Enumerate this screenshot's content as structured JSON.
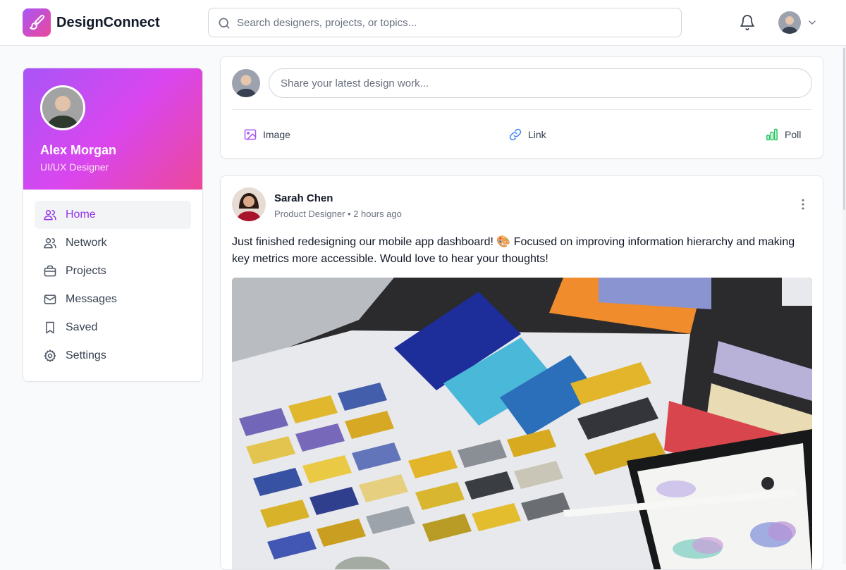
{
  "app": {
    "name": "DesignConnect",
    "brand_gradient": [
      "#a855f7",
      "#ec4899"
    ],
    "accent": "#9333ea",
    "logo_icon": "paintbrush-icon"
  },
  "header": {
    "search_placeholder": "Search designers, projects, or topics...",
    "search_value": "",
    "icons": [
      "search-icon",
      "bell-icon",
      "avatar",
      "chevron-down-icon"
    ]
  },
  "profile": {
    "name": "Alex Morgan",
    "role": "UI/UX Designer"
  },
  "sidebar": {
    "items": [
      {
        "label": "Home",
        "icon": "users-icon",
        "active": true
      },
      {
        "label": "Network",
        "icon": "users-icon",
        "active": false
      },
      {
        "label": "Projects",
        "icon": "briefcase-icon",
        "active": false
      },
      {
        "label": "Messages",
        "icon": "mail-icon",
        "active": false
      },
      {
        "label": "Saved",
        "icon": "bookmark-icon",
        "active": false
      },
      {
        "label": "Settings",
        "icon": "gear-icon",
        "active": false
      }
    ]
  },
  "composer": {
    "placeholder": "Share your latest design work...",
    "actions": [
      {
        "label": "Image",
        "icon": "image-icon",
        "color": "#a855f7"
      },
      {
        "label": "Link",
        "icon": "link-icon",
        "color": "#3b82f6"
      },
      {
        "label": "Poll",
        "icon": "bar-chart-icon",
        "color": "#22c55e"
      }
    ]
  },
  "post": {
    "author": "Sarah Chen",
    "author_title": "Product Designer",
    "time": "2 hours ago",
    "meta": "Product Designer • 2 hours ago",
    "text": "Just finished redesigning our mobile app dashboard! 🎨 Focused on improving information hierarchy and making key metrics more accessible. Would love to hear your thoughts!",
    "image_subject": "color swatch palette book with tablet and stylus"
  }
}
